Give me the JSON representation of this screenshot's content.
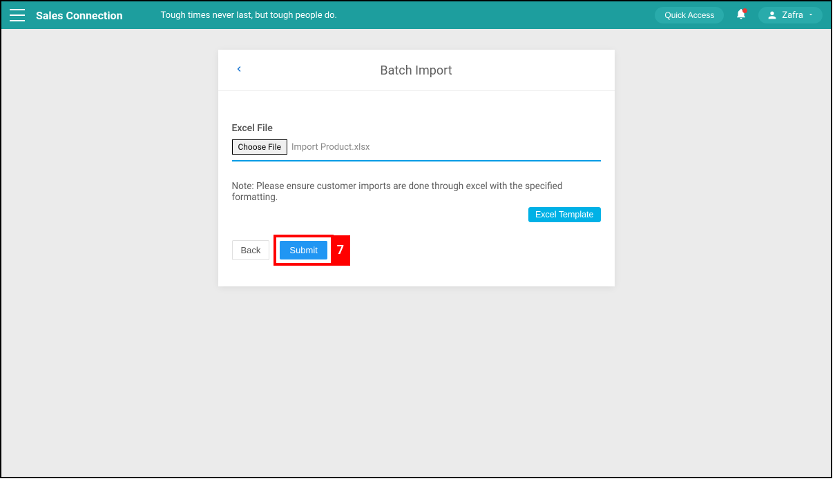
{
  "header": {
    "app_title": "Sales Connection",
    "tagline": "Tough times never last, but tough people do.",
    "quick_access_label": "Quick Access",
    "user_name": "Zafra"
  },
  "card": {
    "title": "Batch Import",
    "field_label": "Excel File",
    "choose_file_label": "Choose File",
    "selected_filename": "Import Product.xlsx",
    "note": "Note: Please ensure customer imports are done through excel with the specified formatting.",
    "excel_template_label": "Excel Template",
    "back_label": "Back",
    "submit_label": "Submit"
  },
  "annotation": {
    "step_number": "7"
  }
}
